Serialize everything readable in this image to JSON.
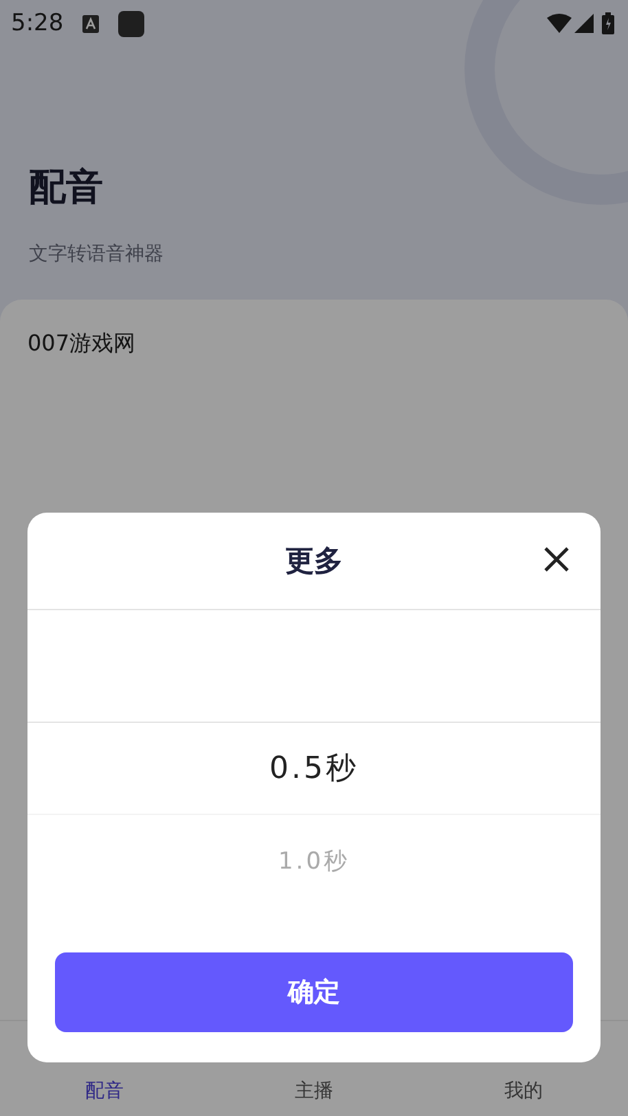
{
  "status_bar": {
    "time": "5:28"
  },
  "header": {
    "title": "配音",
    "subtitle": "文字转语音神器"
  },
  "card": {
    "text": "007游戏网"
  },
  "bottom_nav": [
    {
      "label": "配音",
      "selected": true
    },
    {
      "label": "主播",
      "selected": false
    },
    {
      "label": "我的",
      "selected": false
    }
  ],
  "dialog": {
    "title": "更多",
    "options": [
      {
        "label": "0.5秒",
        "selected": true
      },
      {
        "label": "1.0秒",
        "selected": false
      }
    ],
    "confirm": "确定"
  }
}
